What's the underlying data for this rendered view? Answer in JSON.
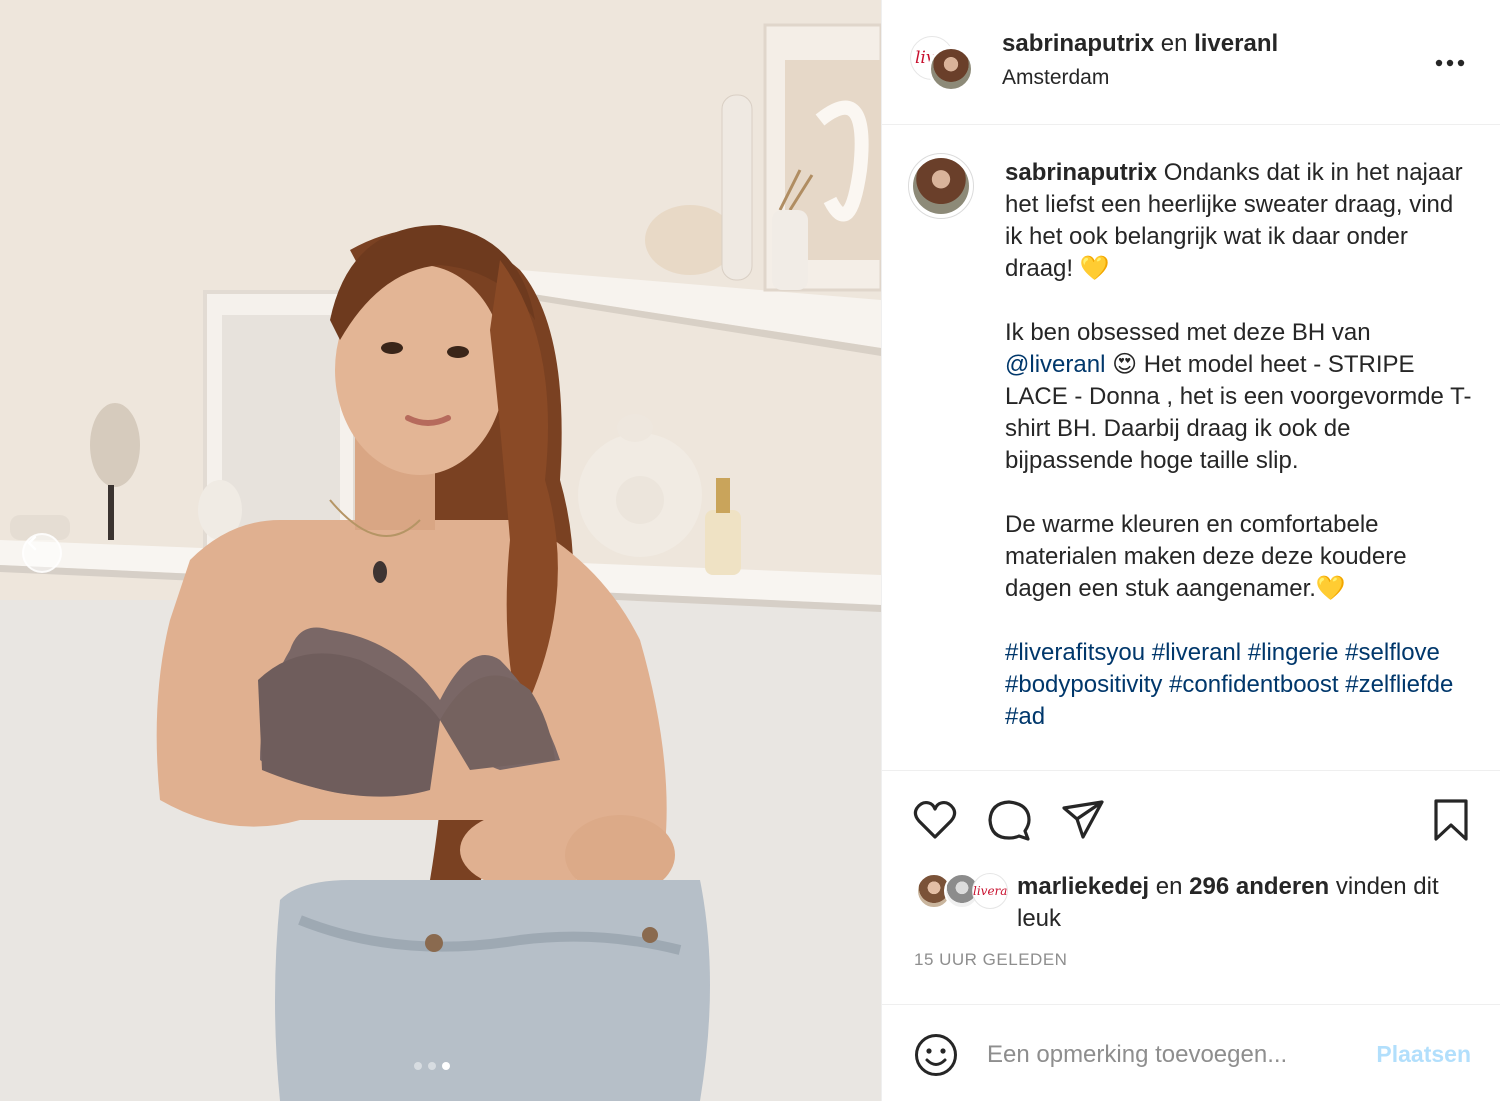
{
  "post": {
    "brand_avatar_text": "livera",
    "username": "sabrinaputrix",
    "joiner": "en",
    "collab_username": "liveranl",
    "location": "Amsterdam",
    "more_icon": "more-options-icon"
  },
  "caption": {
    "username": "sabrinaputrix",
    "paragraph1": "Ondanks dat ik in het najaar het liefst een heerlijke sweater draag, vind ik het ook belangrijk wat ik daar onder draag! 💛",
    "p2_before": "Ik ben obsessed met deze BH van ",
    "p2_mention": "@liveranl",
    "p2_after": " 😍 Het model heet - STRIPE LACE - Donna , het is een voorgevormde T-shirt BH. Daarbij draag ik ook de bijpassende hoge taille slip.",
    "paragraph3": "De warme kleuren en comfortabele materialen maken deze deze koudere dagen een stuk aangenamer.💛",
    "hashtags": "#liverafitsyou #liveranl #lingerie #selflove #bodypositivity #confidentboost #zelfliefde #ad"
  },
  "likes": {
    "liker": "marliekedej",
    "middle": "en",
    "count_text": "296 anderen",
    "suffix": "vinden dit leuk",
    "third_avatar_text": "livera"
  },
  "timestamp": "15 UUR GELEDEN",
  "comment": {
    "placeholder": "Een opmerking toevoegen...",
    "post_label": "Plaatsen"
  },
  "carousel": {
    "slide_count": 3,
    "active_index": 2
  },
  "colors": {
    "link": "#00376b",
    "post_button_disabled": "#b2dffc",
    "muted": "#8e8e8e",
    "brand_red": "#c8102e"
  }
}
